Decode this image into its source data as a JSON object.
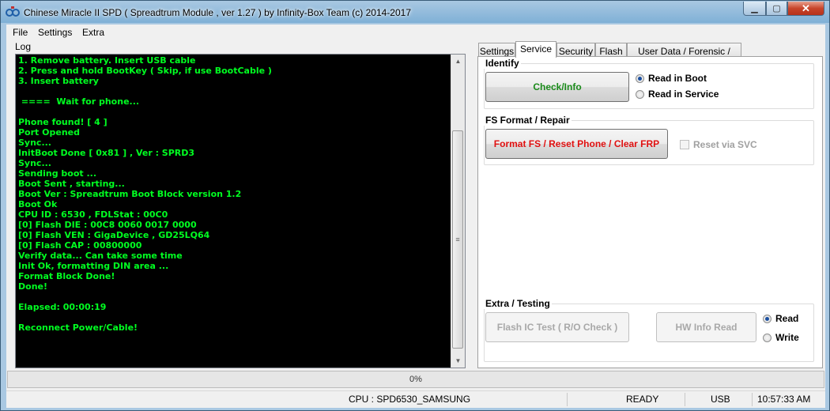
{
  "window": {
    "title": "Chinese Miracle II SPD ( Spreadtrum Module , ver 1.27 ) by Infinity-Box Team (c) 2014-2017",
    "minimize_glyph": "▁",
    "maximize_glyph": "▢",
    "close_glyph": "✕"
  },
  "menu": {
    "items": [
      "File",
      "Settings",
      "Extra"
    ]
  },
  "log": {
    "label": "Log",
    "lines": [
      "1. Remove battery. Insert USB cable",
      "2. Press and hold BootKey ( Skip, if use BootCable )",
      "3. Insert battery",
      "",
      " ====  Wait for phone...",
      "",
      "Phone found! [ 4 ]",
      "Port Opened",
      "Sync...",
      "InitBoot Done [ 0x81 ] , Ver : SPRD3",
      "Sync...",
      "Sending boot ...",
      "Boot Sent , starting...",
      "Boot Ver : Spreadtrum Boot Block version 1.2",
      "Boot Ok",
      "CPU ID : 6530 , FDLStat : 00C0",
      "[0] Flash DIE : 00C8 0060 0017 0000",
      "[0] Flash VEN : GigaDevice , GD25LQ64",
      "[0] Flash CAP : 00800000",
      "Verify data... Can take some time",
      "Init Ok, formatting DIN area ...",
      "Format Block Done!",
      "Done!",
      "",
      "Elapsed: 00:00:19",
      "",
      "Reconnect Power/Cable!"
    ]
  },
  "tabs": [
    {
      "label": "Settings",
      "active": false
    },
    {
      "label": "Service",
      "active": true
    },
    {
      "label": "Security",
      "active": false
    },
    {
      "label": "Flash",
      "active": false
    },
    {
      "label": "User Data / Forensic / Other",
      "active": false
    }
  ],
  "service": {
    "identify": {
      "title": "Identify",
      "button": "Check/Info",
      "button_color": "#1a8a1a",
      "read_in_boot": "Read in Boot",
      "read_in_service": "Read in Service",
      "selected": "boot"
    },
    "fs": {
      "title": "FS Format / Repair",
      "button": "Format FS / Reset Phone / Clear FRP",
      "button_color": "#e01010",
      "checkbox": "Reset via SVC"
    },
    "extra": {
      "title": "Extra / Testing",
      "flash_ic": "Flash IC Test ( R/O Check )",
      "hw_info": "HW Info Read",
      "read": "Read",
      "write": "Write",
      "selected": "read"
    }
  },
  "progress": {
    "text": "0%",
    "value": 0
  },
  "status": {
    "cpu": "CPU : SPD6530_SAMSUNG",
    "state": "READY",
    "conn": "USB",
    "time": "10:57:33 AM"
  }
}
